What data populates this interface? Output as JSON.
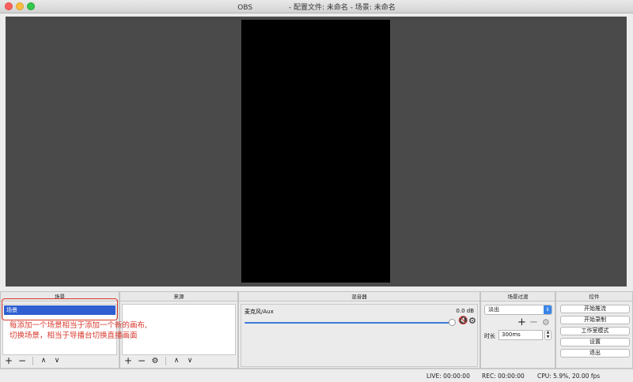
{
  "window": {
    "title": "OBS                - 配置文件: 未命名 - 场景: 未命名"
  },
  "scenes": {
    "header": "场景",
    "items": [
      {
        "label": "场景",
        "selected": true
      }
    ],
    "toolbar": {
      "add": "+",
      "remove": "−",
      "up": "∧",
      "down": "∨"
    }
  },
  "sources": {
    "header": "来源",
    "toolbar": {
      "add": "+",
      "remove": "−",
      "settings": "⚙",
      "up": "∧",
      "down": "∨"
    }
  },
  "mixer": {
    "header": "混音器",
    "channel": {
      "name": "麦克风/Aux",
      "level": "0.0 dB",
      "volume_fraction": 1.0,
      "muted": true
    }
  },
  "transitions": {
    "header": "场景过渡",
    "selected": "淡出",
    "duration_label": "时长",
    "duration_value": "300ms"
  },
  "controls": {
    "header": "控件",
    "buttons": [
      "开始推流",
      "开始录制",
      "工作室模式",
      "设置",
      "退出"
    ]
  },
  "annotation": {
    "line1": "每添加一个场景相当于添加一个新的画布,",
    "line2": "切换场景，相当于导播台切换直播画面",
    "color": "#d9392e"
  },
  "status": {
    "live": "LIVE: 00:00:00",
    "rec": "REC: 00:00:00",
    "cpu": "CPU: 5.9%, 20.00 fps"
  },
  "colors": {
    "accent": "#2f5fd1",
    "preview_bg": "#4a4a4a",
    "canvas": "#000000",
    "mute": "#d02020"
  }
}
